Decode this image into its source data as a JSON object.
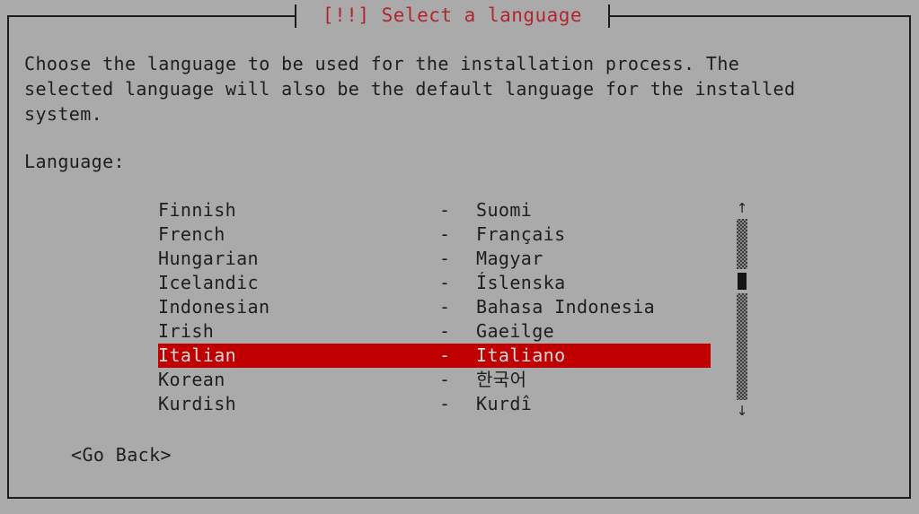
{
  "window": {
    "title": "[!!] Select a language",
    "title_color": "#b02530",
    "background_color": "#aaaaaa",
    "border_color": "#1c1c1c",
    "text_color": "#1e1e1e"
  },
  "main": {
    "description": "Choose the language to be used for the installation process. The\nselected language will also be the default language for the installed\nsystem.",
    "field_label": "Language:",
    "highlight_color": "#c00000",
    "highlight_text_color": "#d8d8d8"
  },
  "language_list": {
    "separator": "-",
    "selected_index": 6,
    "items": [
      {
        "name": "Finnish",
        "native": "Suomi"
      },
      {
        "name": "French",
        "native": "Français"
      },
      {
        "name": "Hungarian",
        "native": "Magyar"
      },
      {
        "name": "Icelandic",
        "native": "Íslenska"
      },
      {
        "name": "Indonesian",
        "native": "Bahasa Indonesia"
      },
      {
        "name": "Irish",
        "native": "Gaeilge"
      },
      {
        "name": "Italian",
        "native": "Italiano"
      },
      {
        "name": "Korean",
        "native": "한국어"
      },
      {
        "name": "Kurdish",
        "native": "Kurdî"
      }
    ]
  },
  "scrollbar": {
    "up_arrow": "↑",
    "down_arrow": "↓"
  },
  "buttons": {
    "go_back": "<Go Back>"
  }
}
